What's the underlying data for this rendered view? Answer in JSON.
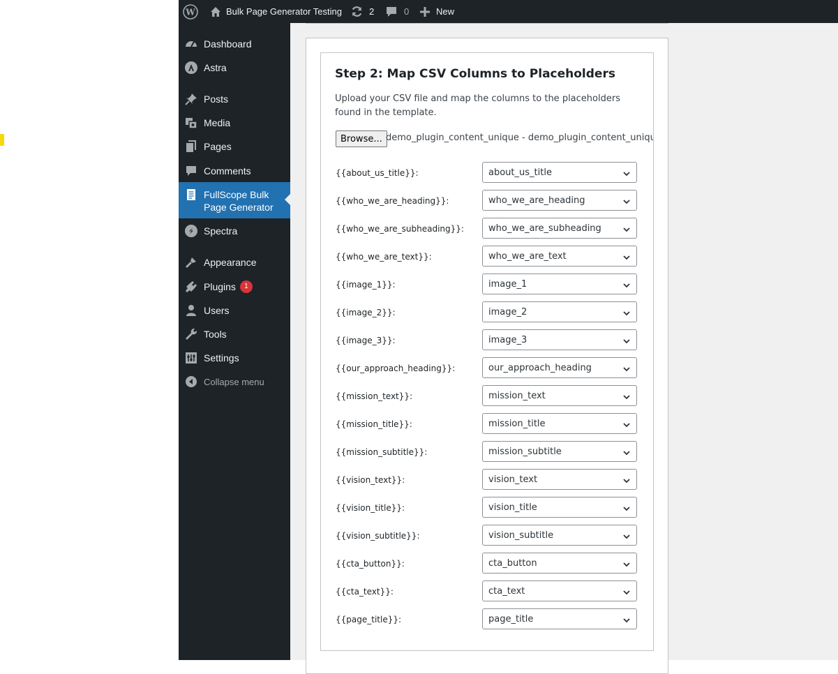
{
  "adminbar": {
    "site_title": "Bulk Page Generator Testing",
    "updates_count": "2",
    "comments_count": "0",
    "new_label": "New"
  },
  "sidebar": {
    "items": [
      {
        "label": "Dashboard",
        "icon": "dashboard-icon"
      },
      {
        "label": "Astra",
        "icon": "astra-icon"
      },
      {
        "label": "Posts",
        "icon": "pushpin-icon"
      },
      {
        "label": "Media",
        "icon": "media-icon"
      },
      {
        "label": "Pages",
        "icon": "pages-icon"
      },
      {
        "label": "Comments",
        "icon": "comment-icon"
      },
      {
        "label": "FullScope Bulk Page Generator",
        "icon": "document-icon"
      },
      {
        "label": "Spectra",
        "icon": "spectra-icon"
      },
      {
        "label": "Appearance",
        "icon": "brush-icon"
      },
      {
        "label": "Plugins",
        "icon": "plugin-icon",
        "badge": "1"
      },
      {
        "label": "Users",
        "icon": "user-icon"
      },
      {
        "label": "Tools",
        "icon": "wrench-icon"
      },
      {
        "label": "Settings",
        "icon": "settings-icon"
      }
    ],
    "active_line1": "FullScope Bulk",
    "active_line2": "Page Generator",
    "collapse_label": "Collapse menu"
  },
  "step2": {
    "title": "Step 2: Map CSV Columns to Placeholders",
    "description": "Upload your CSV file and map the columns to the placeholders found in the template.",
    "browse_label": "Browse...",
    "file_name": "demo_plugin_content_unique - demo_plugin_content_unique (",
    "mappings": [
      {
        "placeholder": "{{about_us_title}}:",
        "value": "about_us_title"
      },
      {
        "placeholder": "{{who_we_are_heading}}:",
        "value": "who_we_are_heading"
      },
      {
        "placeholder": "{{who_we_are_subheading}}:",
        "value": "who_we_are_subheading"
      },
      {
        "placeholder": "{{who_we_are_text}}:",
        "value": "who_we_are_text"
      },
      {
        "placeholder": "{{image_1}}:",
        "value": "image_1"
      },
      {
        "placeholder": "{{image_2}}:",
        "value": "image_2"
      },
      {
        "placeholder": "{{image_3}}:",
        "value": "image_3"
      },
      {
        "placeholder": "{{our_approach_heading}}:",
        "value": "our_approach_heading"
      },
      {
        "placeholder": "{{mission_text}}:",
        "value": "mission_text"
      },
      {
        "placeholder": "{{mission_title}}:",
        "value": "mission_title"
      },
      {
        "placeholder": "{{mission_subtitle}}:",
        "value": "mission_subtitle"
      },
      {
        "placeholder": "{{vision_text}}:",
        "value": "vision_text"
      },
      {
        "placeholder": "{{vision_title}}:",
        "value": "vision_title"
      },
      {
        "placeholder": "{{vision_subtitle}}:",
        "value": "vision_subtitle"
      },
      {
        "placeholder": "{{cta_button}}:",
        "value": "cta_button"
      },
      {
        "placeholder": "{{cta_text}}:",
        "value": "cta_text"
      },
      {
        "placeholder": "{{page_title}}:",
        "value": "page_title"
      }
    ]
  },
  "colors": {
    "admin_dark": "#1d2327",
    "accent_blue": "#2271b1",
    "badge_red": "#d63638",
    "content_bg": "#f0f0f1"
  }
}
